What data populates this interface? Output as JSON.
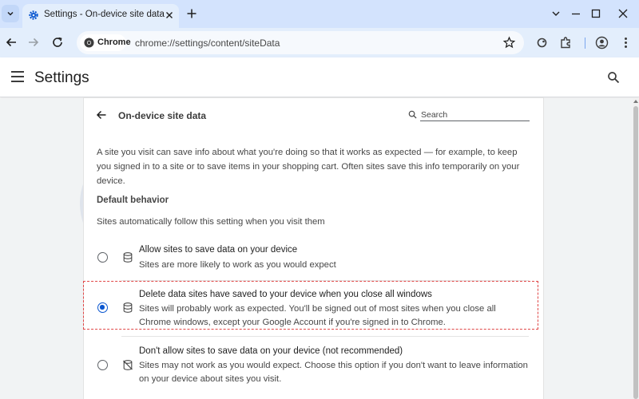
{
  "browser": {
    "tab_title": "Settings - On-device site data",
    "chip_label": "Chrome",
    "url": "chrome://settings/content/siteData"
  },
  "header": {
    "title": "Settings"
  },
  "page": {
    "title": "On-device site data",
    "search_placeholder": "Search",
    "intro": "A site you visit can save info about what you're doing so that it works as expected — for example, to keep you signed in to a site or to save items in your shopping cart. Often sites save this info temporarily on your device.",
    "section_title": "Default behavior",
    "section_subtitle": "Sites automatically follow this setting when you visit them",
    "options": [
      {
        "label": "Allow sites to save data on your device",
        "description": "Sites are more likely to work as you would expect",
        "icon": "database-icon",
        "checked": false
      },
      {
        "label": "Delete data sites have saved to your device when you close all windows",
        "description": "Sites will probably work as expected. You'll be signed out of most sites when you close all Chrome windows, except your Google Account if you're signed in to Chrome.",
        "icon": "database-icon",
        "checked": true
      },
      {
        "label": "Don't allow sites to save data on your device (not recommended)",
        "description": "Sites may not work as you would expect. Choose this option if you don't want to leave information on your device about sites you visit.",
        "icon": "database-off-icon",
        "checked": false
      }
    ]
  },
  "watermark": {
    "text": "Safelyo"
  },
  "colors": {
    "accent": "#0b57d0",
    "highlight_border": "#e04848",
    "tabstrip": "#d3e3fd"
  }
}
